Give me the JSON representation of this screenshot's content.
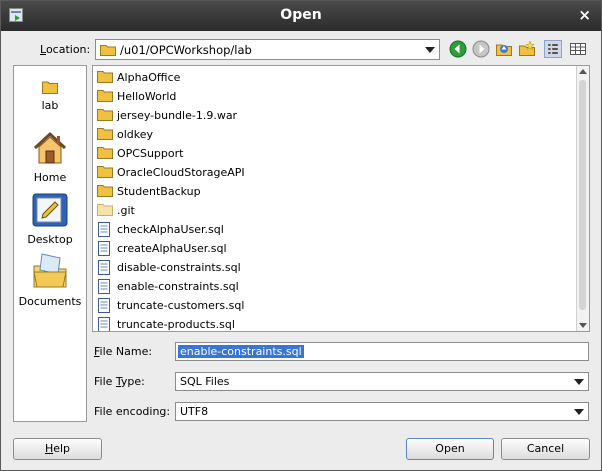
{
  "dialog": {
    "title": "Open",
    "close_glyph": "×"
  },
  "location": {
    "label_key": "L",
    "label_rest": "ocation:",
    "path": "/u01/OPCWorkshop/lab",
    "toolbar_icons": [
      "back-icon",
      "forward-icon",
      "up-folder-icon",
      "new-folder-icon",
      "list-view-icon",
      "details-view-icon"
    ]
  },
  "places": [
    {
      "label": "lab",
      "icon": "folder-icon"
    },
    {
      "label": "Home",
      "icon": "home-icon"
    },
    {
      "label": "Desktop",
      "icon": "desktop-icon"
    },
    {
      "label": "Documents",
      "icon": "documents-icon"
    }
  ],
  "files": [
    {
      "name": "AlphaOffice",
      "type": "folder"
    },
    {
      "name": "HelloWorld",
      "type": "folder"
    },
    {
      "name": "jersey-bundle-1.9.war",
      "type": "folder"
    },
    {
      "name": "oldkey",
      "type": "folder"
    },
    {
      "name": "OPCSupport",
      "type": "folder"
    },
    {
      "name": "OracleCloudStorageAPI",
      "type": "folder"
    },
    {
      "name": "StudentBackup",
      "type": "folder"
    },
    {
      "name": ".git",
      "type": "hidden-folder"
    },
    {
      "name": "checkAlphaUser.sql",
      "type": "file"
    },
    {
      "name": "createAlphaUser.sql",
      "type": "file"
    },
    {
      "name": "disable-constraints.sql",
      "type": "file"
    },
    {
      "name": "enable-constraints.sql",
      "type": "file"
    },
    {
      "name": "truncate-customers.sql",
      "type": "file"
    },
    {
      "name": "truncate-products.sql",
      "type": "file"
    }
  ],
  "file_name": {
    "label_key": "F",
    "label_rest": "ile Name:",
    "value": "enable-constraints.sql"
  },
  "file_type": {
    "label_pre": "File ",
    "label_key": "T",
    "label_rest": "ype:",
    "value": "SQL Files"
  },
  "encoding": {
    "label": "File encoding:",
    "value": "UTF8"
  },
  "buttons": {
    "help_key": "H",
    "help_rest": "elp",
    "open": "Open",
    "cancel": "Cancel"
  },
  "colors": {
    "selection": "#3875d7",
    "folder": "#f0c040"
  }
}
